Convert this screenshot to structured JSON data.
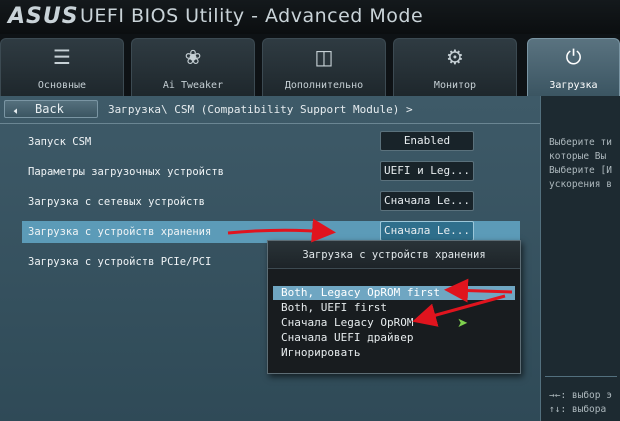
{
  "window": {
    "logo": "ASUS",
    "title": "UEFI BIOS Utility - Advanced Mode"
  },
  "tabs": [
    {
      "label": "Основные",
      "icon": "list-icon",
      "active": false
    },
    {
      "label": "Ai Tweaker",
      "icon": "fan-icon",
      "active": false
    },
    {
      "label": "Дополнительно",
      "icon": "network-icon",
      "active": false
    },
    {
      "label": "Монитор",
      "icon": "thermometer-gear-icon",
      "active": false
    },
    {
      "label": "Загрузка",
      "icon": "power-icon",
      "active": true
    }
  ],
  "nav": {
    "back_label": "Back",
    "breadcrumb": "Загрузка\\ CSM (Compatibility Support Module) >"
  },
  "settings": [
    {
      "label": "Запуск CSM",
      "value": "Enabled",
      "selected": false
    },
    {
      "label": "Параметры загрузочных устройств",
      "value": "UEFI и Leg...",
      "selected": false
    },
    {
      "label": "Загрузка с сетевых устройств",
      "value": "Сначала Le...",
      "selected": false
    },
    {
      "label": "Загрузка с устройств хранения",
      "value": "Сначала Le...",
      "selected": true
    },
    {
      "label": "Загрузка с  устройств PCIe/PCI",
      "value": "",
      "selected": false
    }
  ],
  "popup": {
    "title": "Загрузка с устройств хранения",
    "options": [
      {
        "label": "Both, Legacy OpROM first",
        "highlighted": true
      },
      {
        "label": "Both, UEFI first",
        "highlighted": false
      },
      {
        "label": "Сначала Legacy OpROM",
        "highlighted": false
      },
      {
        "label": "Сначала UEFI драйвер",
        "highlighted": false
      },
      {
        "label": "Игнорировать",
        "highlighted": false
      }
    ]
  },
  "help": {
    "lines": [
      "Выберите ти",
      "которые Вы",
      "Выберите [И",
      "ускорения в"
    ],
    "hint_select": "→←: выбор э",
    "hint_choose": "↑↓: выбора"
  },
  "colors": {
    "accent": "#5c9bb8",
    "annotation_arrow": "#e0141e",
    "cursor": "#7fd14e"
  }
}
